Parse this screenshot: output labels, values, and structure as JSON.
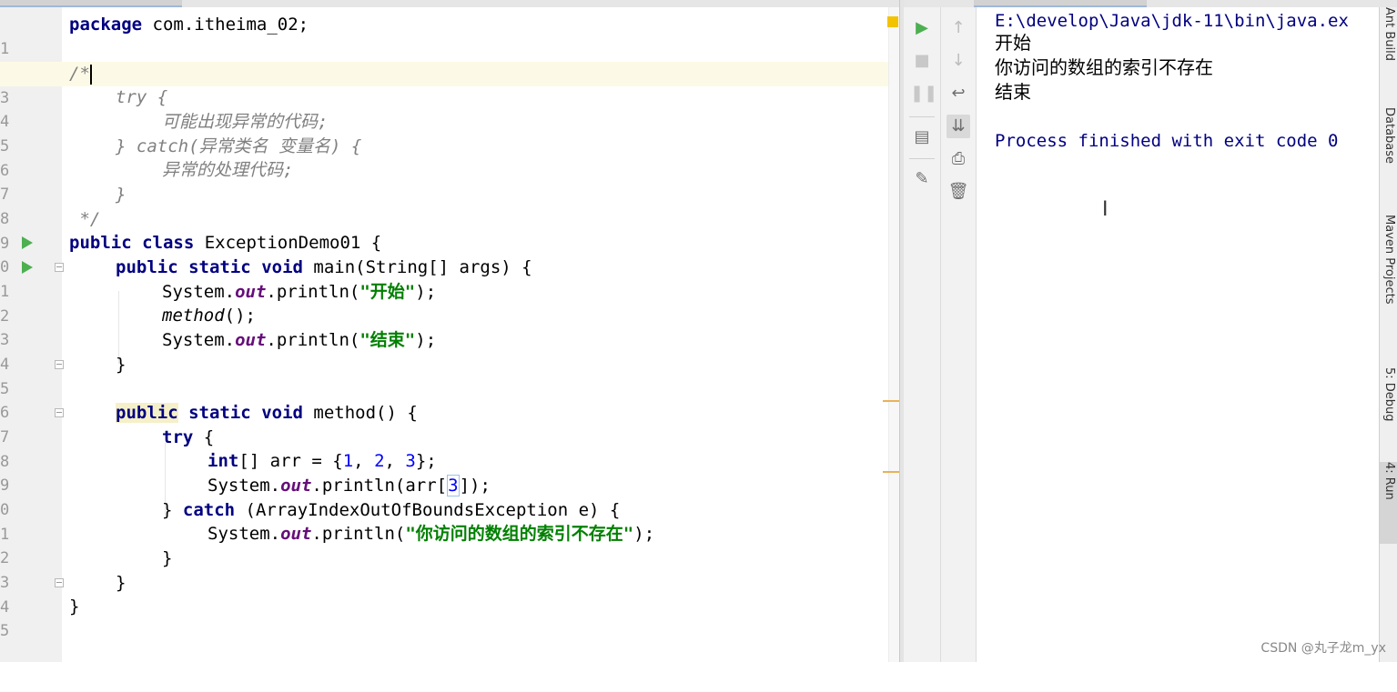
{
  "editor": {
    "lines": [
      {
        "n": "1"
      },
      {
        "n": "2"
      },
      {
        "n": "3"
      },
      {
        "n": "4"
      },
      {
        "n": "5"
      },
      {
        "n": "6"
      },
      {
        "n": "7"
      },
      {
        "n": "8"
      },
      {
        "n": "9"
      },
      {
        "n": "0"
      },
      {
        "n": "1"
      },
      {
        "n": "2"
      },
      {
        "n": "3"
      },
      {
        "n": "4"
      },
      {
        "n": "5"
      },
      {
        "n": "6"
      },
      {
        "n": "7"
      },
      {
        "n": "8"
      },
      {
        "n": "9"
      },
      {
        "n": "0"
      },
      {
        "n": "1"
      },
      {
        "n": "2"
      },
      {
        "n": "3"
      },
      {
        "n": "4"
      },
      {
        "n": "5"
      }
    ],
    "tokens": {
      "package": "package",
      "pkg_name": " com.itheima_02;",
      "comment_open": "/*",
      "c_try": "try {",
      "c_body1": "可能出现异常的代码;",
      "c_catch": "} catch(异常类名 变量名) {",
      "c_body2": "异常的处理代码;",
      "c_close_brace": "}",
      "comment_close": " */",
      "public": "public",
      "class": "class",
      "class_name": " ExceptionDemo01 {",
      "static": "static",
      "void": "void",
      "main_sig": " main(String[] args) {",
      "system": "System.",
      "out": "out",
      "println_open": ".println(",
      "str_start": "\"开始\"",
      "str_end": "\"结束\"",
      "close_call": ");",
      "method_call": "method",
      "method_call_end": "();",
      "brace_close": "}",
      "method_sig": " method() {",
      "try": "try",
      "brace_open": " {",
      "int": "int",
      "arr_decl_a": "[] arr = {",
      "num1": "1",
      "comma": ", ",
      "num2": "2",
      "num3": "3",
      "arr_decl_b": "};",
      "arr_access_a": "arr[",
      "arr_access_b": "]);",
      "catch_lead": "} ",
      "catch": "catch",
      "catch_sig": " (ArrayIndexOutOfBoundsException e) {",
      "str_err": "\"你访问的数组的索引不存在\""
    }
  },
  "console": {
    "path": "E:\\develop\\Java\\jdk-11\\bin\\java.ex",
    "out1": "开始",
    "out2": "你访问的数组的索引不存在",
    "out3": "结束",
    "exit": "Process finished with exit code 0"
  },
  "toolbar": {
    "rerun_icon": "play-icon",
    "stop_icon": "stop-icon",
    "pause_icon": "pause-icon",
    "layout_icon": "layout-icon",
    "pin_icon": "pin-icon",
    "up_icon": "arrow-up-icon",
    "down_icon": "arrow-down-icon",
    "wrap_icon": "soft-wrap-icon",
    "scroll_end_icon": "scroll-to-end-icon",
    "print_icon": "print-icon",
    "trash_icon": "trash-icon"
  },
  "side_tabs": {
    "ant": "Ant Build",
    "database": "Database",
    "maven": "Maven Projects",
    "debug": "5: Debug",
    "run": "4: Run"
  },
  "watermark": "CSDN @丸子龙m_yx",
  "colors": {
    "keyword": "#000080",
    "string": "#008000",
    "field": "#660e7a",
    "number": "#0000ff",
    "comment": "#808080",
    "run_green": "#4caf50"
  }
}
